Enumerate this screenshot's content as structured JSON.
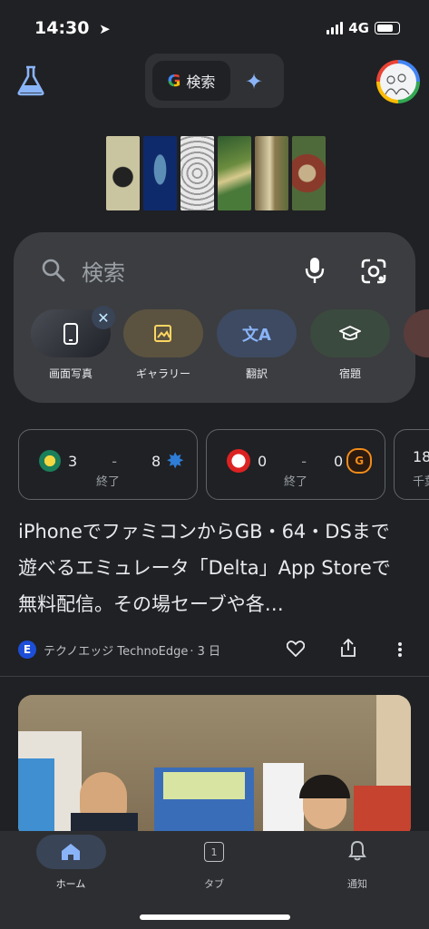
{
  "status_bar": {
    "time": "14:30",
    "network": "4G"
  },
  "top_bar": {
    "search_toggle_label": "検索"
  },
  "search": {
    "placeholder": "検索"
  },
  "chips": [
    {
      "label": "画面写真"
    },
    {
      "label": "ギャラリー"
    },
    {
      "label": "翻訳"
    },
    {
      "label": "宿題"
    }
  ],
  "scores": [
    {
      "home_score": "3",
      "separator": "-",
      "away_score": "8",
      "status": "終了"
    },
    {
      "home_score": "0",
      "separator": "-",
      "away_score": "0",
      "status": "終了"
    },
    {
      "partial_score": "18",
      "partial_text": "千葉"
    }
  ],
  "article": {
    "headline": "iPhoneでファミコンからGB・64・DSまで遊べるエミュレータ「Delta」App Storeで無料配信。その場セーブや各…",
    "source_name": "テクノエッジ TechnoEdge",
    "age": "· 3 日",
    "source_logo_letter": "E"
  },
  "bottom_nav": {
    "home_label": "ホーム",
    "tabs_label": "タブ",
    "tabs_count": "1",
    "notifications_label": "通知"
  },
  "colors": {
    "accent": "#8ab4f8",
    "background": "#202124",
    "card": "#3c3d40"
  }
}
